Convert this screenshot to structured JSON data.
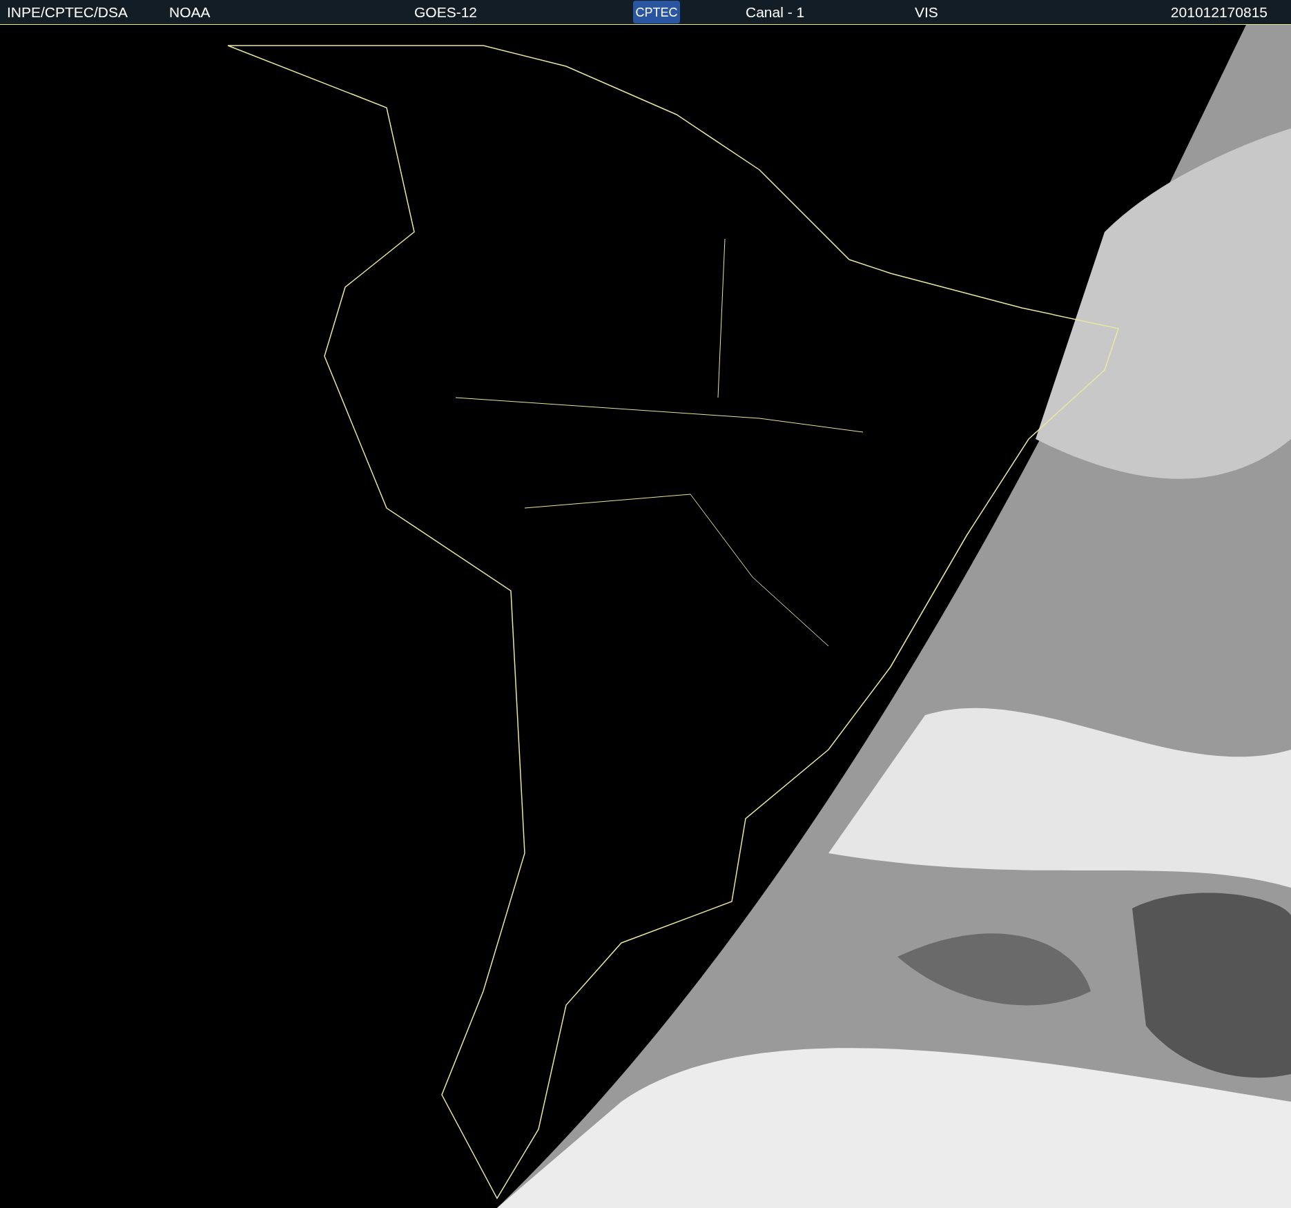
{
  "header": [
    {
      "kind": "text",
      "text": "INPE/CPTEC/DSA"
    },
    {
      "kind": "text",
      "text": "NOAA"
    },
    {
      "kind": "text",
      "text": "GOES-12"
    },
    {
      "kind": "logo",
      "text": "CPTEC"
    },
    {
      "kind": "text",
      "text": "Canal - 1"
    },
    {
      "kind": "text",
      "text": "VIS"
    },
    {
      "kind": "text",
      "text": "201012170815"
    }
  ]
}
